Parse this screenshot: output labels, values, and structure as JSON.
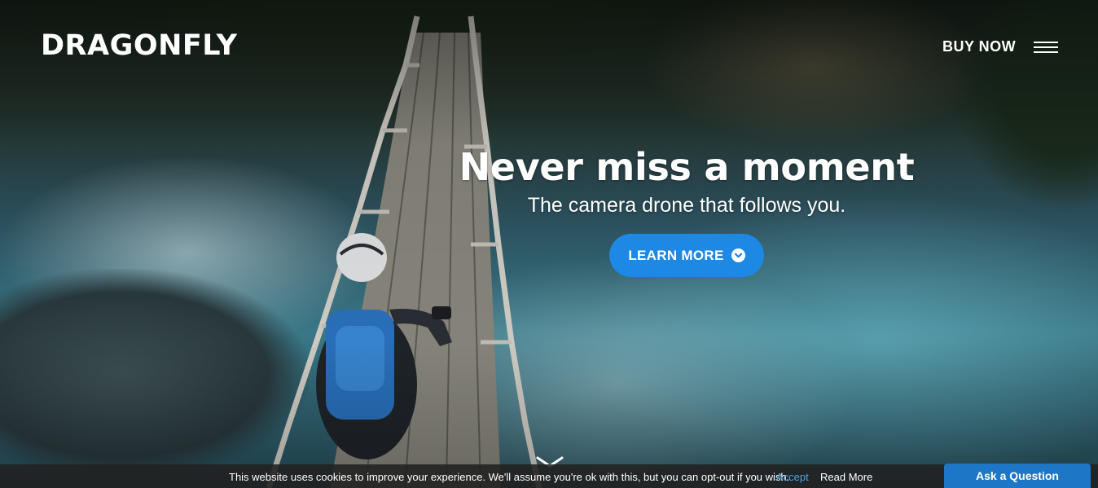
{
  "header": {
    "logo": "DRAGONFLY",
    "buy_now": "BUY NOW",
    "menu_icon": "hamburger-menu-icon"
  },
  "hero": {
    "headline": "Never miss a moment",
    "subheadline": "The camera drone that follows you.",
    "cta_label": "LEARN MORE",
    "cta_icon": "chevron-down-circle-icon",
    "scroll_icon": "chevron-down-icon"
  },
  "cookie_bar": {
    "message": "This website uses cookies to improve your experience. We'll assume you're ok with this, but you can opt-out if you wish.",
    "accept": "Accept",
    "read_more": "Read More"
  },
  "chat": {
    "ask_label": "Ask a Question"
  },
  "colors": {
    "accent": "#1e88e5",
    "link": "#4fa3e3",
    "cookie_bg": "#212121"
  }
}
